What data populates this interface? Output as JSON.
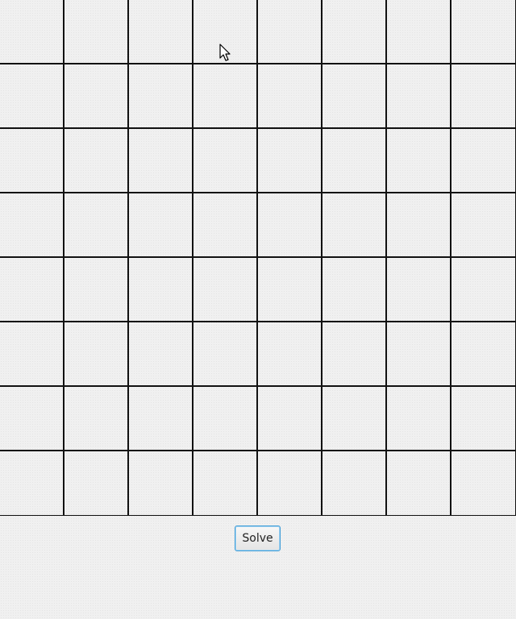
{
  "board": {
    "rows": 8,
    "columns": 8
  },
  "actions": {
    "solve_label": "Solve"
  },
  "colors": {
    "background": "#f0f0f0",
    "grid_line": "#111111",
    "button_focus_border": "#3c9bd6"
  },
  "icons": {
    "cursor": "mouse-pointer-icon"
  }
}
